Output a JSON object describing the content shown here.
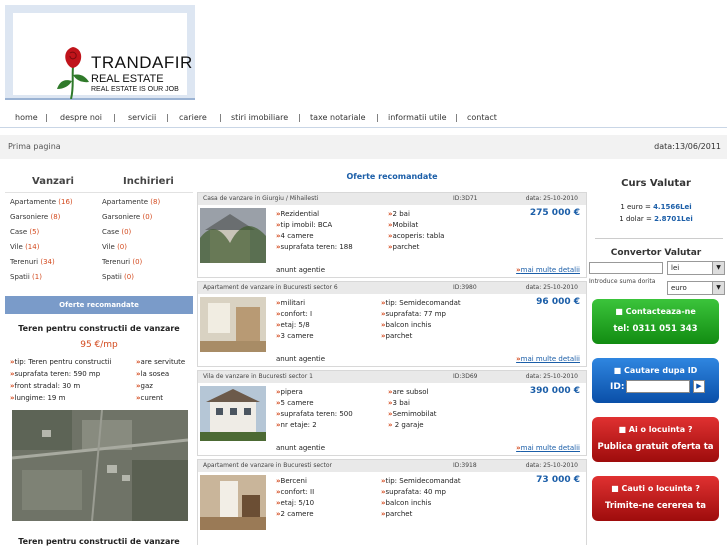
{
  "header": {
    "logo_title": "TRANDAFIR",
    "logo_subtitle": "REAL ESTATE",
    "logo_slogan": "REAL ESTATE IS OUR JOB"
  },
  "nav": [
    "home",
    "despre noi",
    "servicii",
    "cariere",
    "stiri imobiliare",
    "taxe notariale",
    "informatii utile",
    "contact"
  ],
  "nav_sep": "|",
  "breadcrumb": "Prima pagina",
  "date": "data:13/06/2011",
  "left": {
    "vanzari_head": "Vanzari",
    "inchirieri_head": "Inchirieri",
    "vanzari": [
      {
        "label": "Apartamente",
        "count": "(16)"
      },
      {
        "label": "Garsoniere",
        "count": "(8)"
      },
      {
        "label": "Case",
        "count": "(5)"
      },
      {
        "label": "Vile",
        "count": "(14)"
      },
      {
        "label": "Terenuri",
        "count": "(34)"
      },
      {
        "label": "Spatii",
        "count": "(1)"
      }
    ],
    "inchirieri": [
      {
        "label": "Apartamente",
        "count": "(8)"
      },
      {
        "label": "Garsoniere",
        "count": "(0)"
      },
      {
        "label": "Case",
        "count": "(0)"
      },
      {
        "label": "Vile",
        "count": "(0)"
      },
      {
        "label": "Terenuri",
        "count": "(0)"
      },
      {
        "label": "Spatii",
        "count": "(0)"
      }
    ],
    "oferte_bar": "Oferte recomandate",
    "promo": {
      "title": "Teren pentru constructii de vanzare",
      "price": "95 €/mp",
      "features": [
        "tip: Teren pentru constructii",
        "are servitute",
        "suprafata teren: 590 mp",
        "la sosea",
        "front stradal: 30 m",
        "gaz",
        "lungime: 19 m",
        "curent"
      ],
      "title2": "Teren pentru constructii de vanzare"
    }
  },
  "center": {
    "title": "Oferte recomandate",
    "listings": [
      {
        "title": "Casa de vanzare in Giurgiu / Mihailesti",
        "id": "ID:3D71",
        "date": "data: 25-10-2010",
        "price": "275 000 €",
        "col1": [
          "Rezidential",
          "tip imobil: BCA",
          "4 camere",
          "suprafata teren: 188"
        ],
        "col2": [
          "2 bai",
          "Mobilat",
          "acoperis: tabla",
          "parchet"
        ],
        "agent": "anunt agentie",
        "more": "mai multe detalii"
      },
      {
        "title": "Apartament de vanzare in Bucuresti sector 6",
        "id": "ID:3980",
        "date": "data: 25-10-2010",
        "price": "96 000 €",
        "col1": [
          "militari",
          "confort: I",
          "etaj: 5/8",
          "3 camere"
        ],
        "col2": [
          "tip: Semidecomandat",
          "suprafata: 77 mp",
          "balcon inchis",
          "parchet"
        ],
        "agent": "anunt agentie",
        "more": "mai multe detalii"
      },
      {
        "title": "Vila de vanzare in Bucuresti sector 1",
        "id": "ID:3D69",
        "date": "data: 25-10-2010",
        "price": "390 000 €",
        "col1": [
          "pipera",
          "5 camere",
          "suprafata teren: 500",
          "nr etaje: 2"
        ],
        "col2": [
          "are subsol",
          "3 bai",
          "Semimobilat",
          " 2 garaje"
        ],
        "agent": "anunt agentie",
        "more": "mai multe detalii"
      },
      {
        "title": "Apartament de vanzare in Bucuresti sector",
        "id": "ID:3918",
        "date": "data: 25-10-2010",
        "price": "73 000 €",
        "col1": [
          "Berceni",
          "confort: II",
          "etaj: 5/10",
          "2 camere"
        ],
        "col2": [
          "tip: Semidecomandat",
          "suprafata: 40 mp",
          "balcon inchis",
          "parchet"
        ],
        "agent": "",
        "more": ""
      }
    ]
  },
  "right": {
    "curs_head": "Curs Valutar",
    "euro_label": "1 euro = ",
    "euro_value": "4.1566Lei",
    "dolar_label": "1 dolar = ",
    "dolar_value": "2.8701Lei",
    "convertor_head": "Convertor Valutar",
    "sel_lei": "lei",
    "sel_euro": "euro",
    "amount_label": "Introduce suma dorita",
    "btn_contact_l1": "Contacteaza-ne",
    "btn_contact_l2": "tel: 0311 051 343",
    "btn_search_l1": "Cautare dupa ID",
    "btn_search_id": "ID:",
    "btn_publish_l1": "Ai o locuinta ?",
    "btn_publish_l2": "Publica gratuit oferta ta",
    "btn_request_l1": "Cauti o locuinta ?",
    "btn_request_l2": "Trimite-ne cererea ta"
  },
  "colors": {
    "accent_blue": "#1b5ea8",
    "accent_orange": "#d34a1e",
    "bar_blue": "#7a9bc9"
  }
}
